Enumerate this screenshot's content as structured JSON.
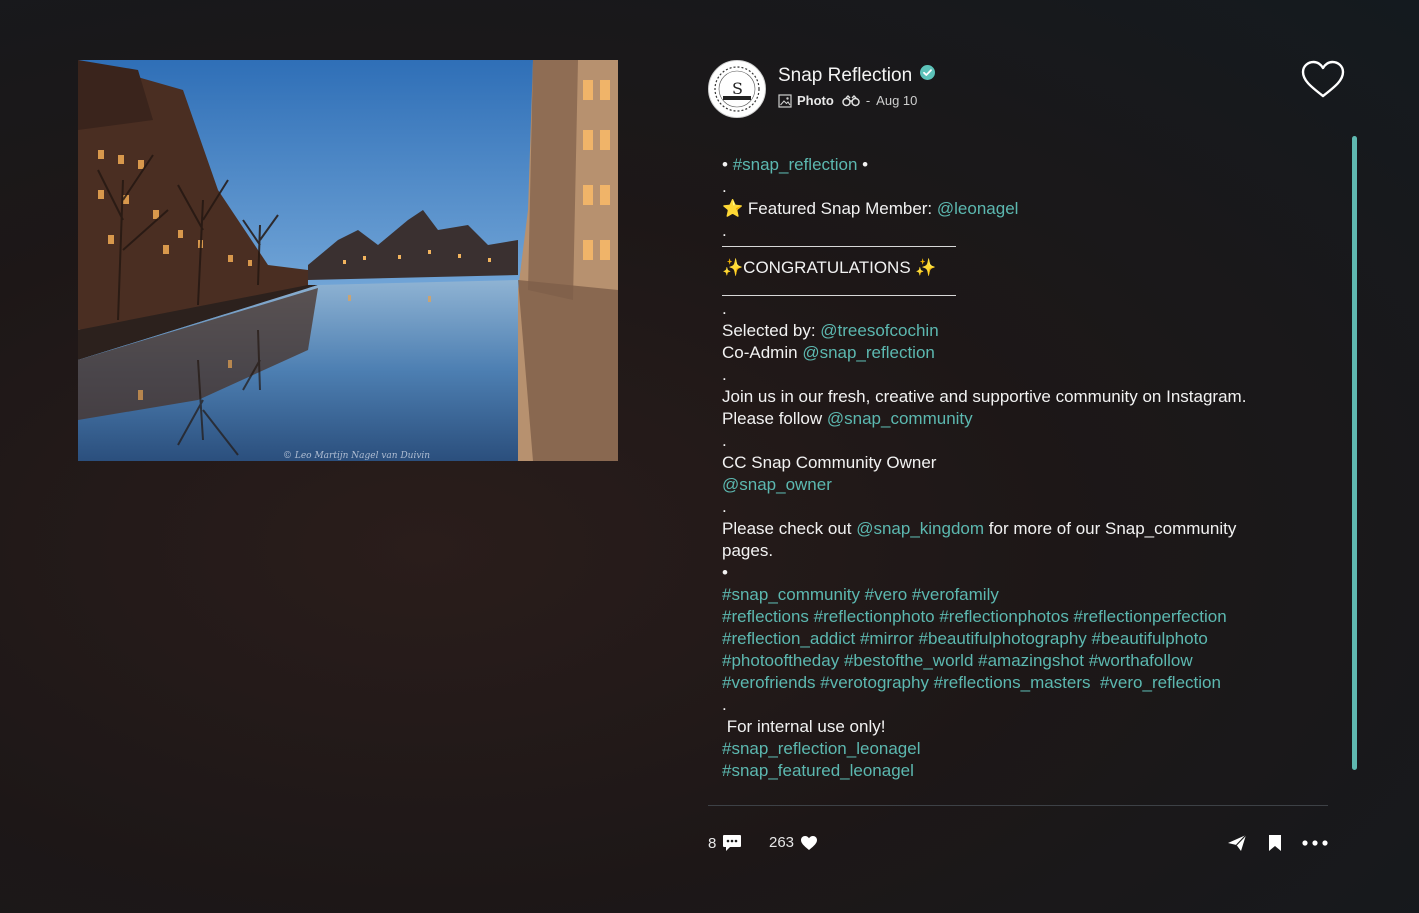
{
  "post": {
    "author": "Snap Reflection",
    "type_label": "Photo",
    "separator": "-",
    "date": "Aug 10",
    "photo_credit": "© Leo Martijn Nagel van Duivin"
  },
  "caption": {
    "line1_bullet_start": "• ",
    "line1_tag": "#snap_reflection",
    "line1_bullet_end": " •",
    "dot": ".",
    "featured_star": "⭐",
    "featured_label": " Featured Snap Member: ",
    "featured_handle": "@leonagel",
    "congrats": "✨CONGRATULATIONS ✨",
    "selected_label": "Selected by: ",
    "selected_handle": "@treesofcochin",
    "coadmin_label": "Co-Admin ",
    "coadmin_handle": "@snap_reflection",
    "join_text": "Join us in our fresh, creative and supportive community on Instagram.",
    "follow_label": "Please follow ",
    "follow_handle": "@snap_community",
    "cc_owner": "CC Snap Community Owner",
    "owner_handle": "@snap_owner",
    "checkout_label": "Please check out ",
    "checkout_handle": "@snap_kingdom",
    "checkout_rest": " for more of our Snap_community pages.",
    "bullet": "•",
    "hashtag_lines": [
      "#snap_community #vero #verofamily",
      "#reflections #reflectionphoto #reflectionphotos #reflectionperfection",
      "#reflection_addict #mirror #beautifulphotography #beautifulphoto",
      "#photooftheday #bestofthe_world #amazingshot #worthafollow",
      "#verofriends #verotography #reflections_masters  #vero_reflection"
    ],
    "internal_note": " For internal use only!",
    "internal_tag_1": "#snap_reflection_leonagel",
    "internal_tag_2": "#snap_featured_leonagel"
  },
  "footer": {
    "comment_count": "8",
    "like_count": "263"
  },
  "icons": {
    "verified": "verified-badge-icon",
    "photo": "photo-icon",
    "view": "binoculars-icon",
    "like": "heart-outline-icon",
    "comment": "comment-icon",
    "like_filled": "heart-icon",
    "share": "send-icon",
    "save": "bookmark-icon",
    "more": "more-icon"
  },
  "colors": {
    "link": "#5cb8b0",
    "verified": "#5cc2b9",
    "scrollbar": "#5fb8b0"
  }
}
